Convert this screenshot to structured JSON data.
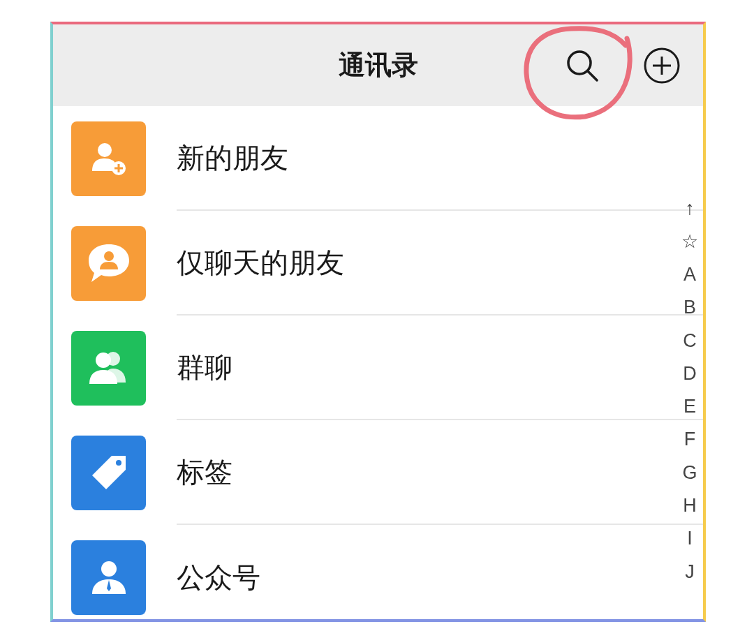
{
  "header": {
    "title": "通讯录"
  },
  "rows": [
    {
      "label": "新的朋友",
      "kind": "new-friend",
      "color": "#f79c38"
    },
    {
      "label": "仅聊天的朋友",
      "kind": "chat-only",
      "color": "#f79c38"
    },
    {
      "label": "群聊",
      "kind": "group",
      "color": "#1fbf5c"
    },
    {
      "label": "标签",
      "kind": "tag",
      "color": "#2b80de"
    },
    {
      "label": "公众号",
      "kind": "official",
      "color": "#2b80de"
    }
  ],
  "index": [
    "↑",
    "☆",
    "A",
    "B",
    "C",
    "D",
    "E",
    "F",
    "G",
    "H",
    "I",
    "J"
  ]
}
